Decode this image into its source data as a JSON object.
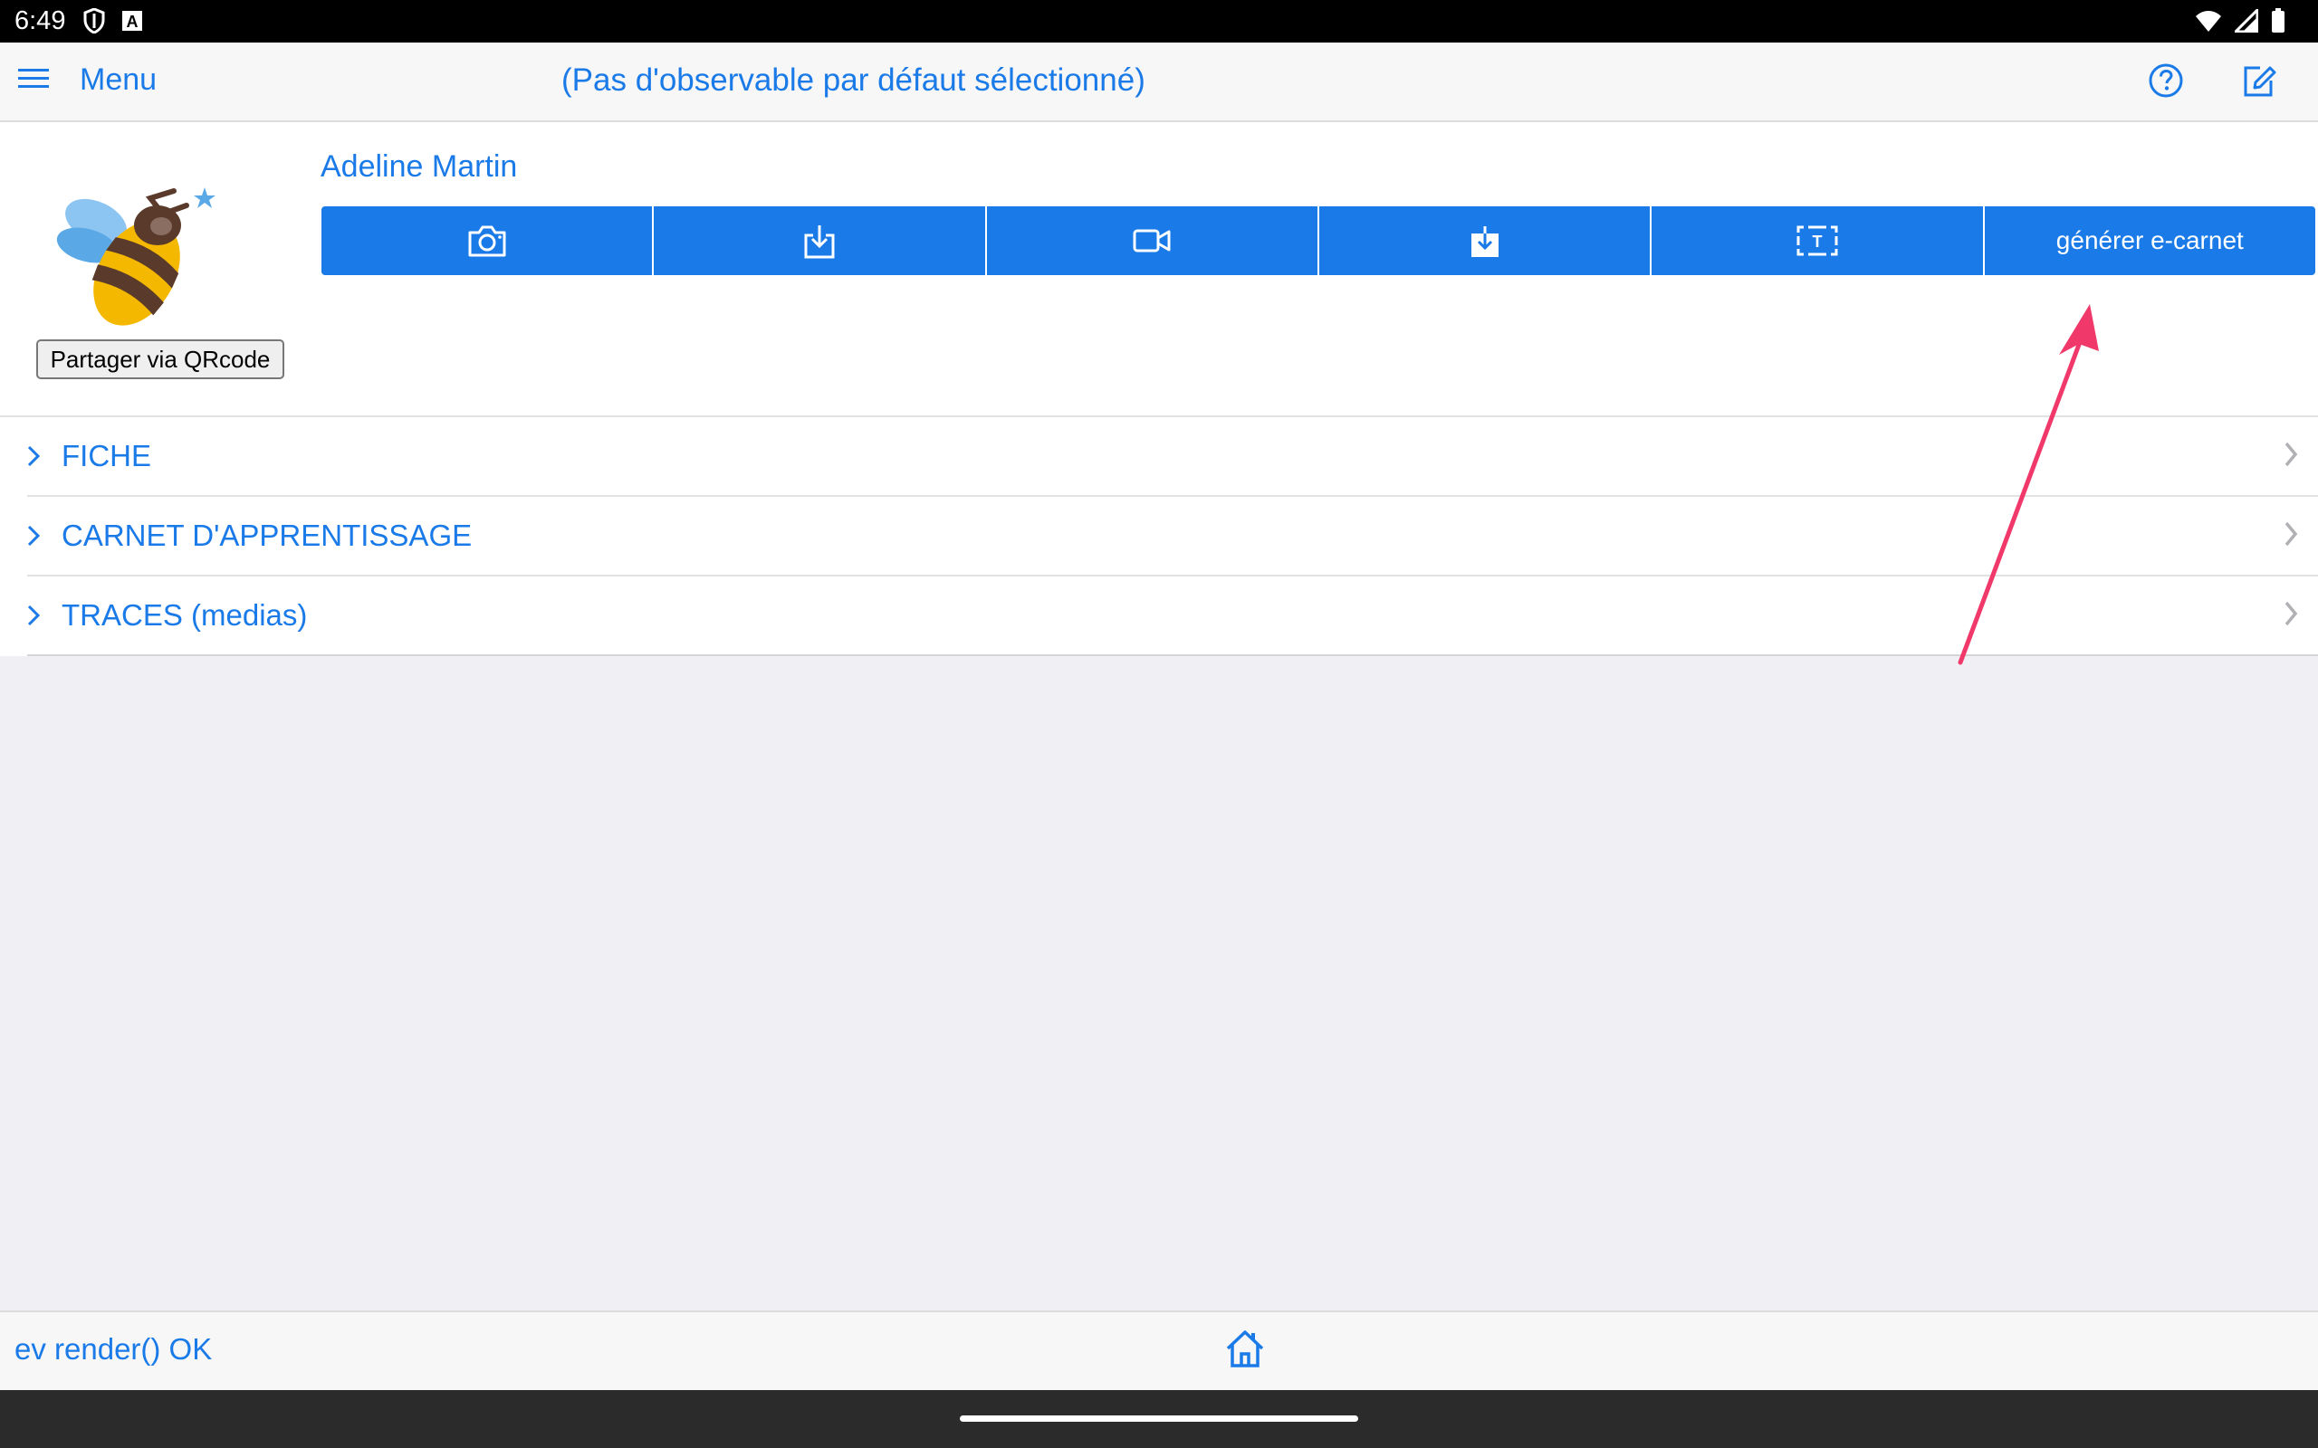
{
  "status_bar": {
    "time": "6:49"
  },
  "app_bar": {
    "menu_label": "Menu",
    "title": "(Pas d'observable par défaut sélectionné)"
  },
  "profile": {
    "name": "Adeline Martin",
    "share_button": "Partager via QRcode",
    "toolbar": {
      "camera_icon": "camera-icon",
      "import_icon": "download-tray-icon",
      "video_icon": "video-camera-icon",
      "save_icon": "download-filled-icon",
      "text_icon": "text-box-icon",
      "generate_label": "générer e-carnet"
    }
  },
  "sections": [
    {
      "label": "FICHE"
    },
    {
      "label": "CARNET D'APPRENTISSAGE"
    },
    {
      "label": "TRACES (medias)"
    }
  ],
  "bottom_bar": {
    "status": "ev render() OK"
  },
  "colors": {
    "accent": "#1a7ae8",
    "annotation": "#f0396a"
  }
}
